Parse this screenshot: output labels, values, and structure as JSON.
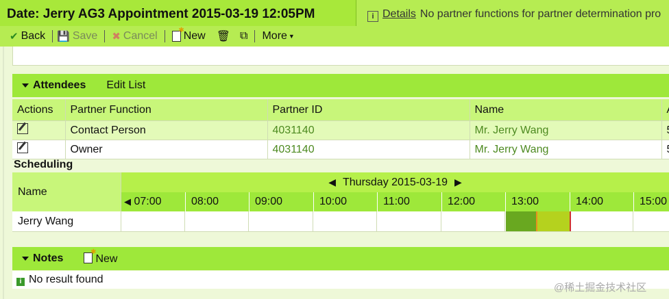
{
  "title": "Date: Jerry AG3 Appointment 2015-03-19 12:05PM",
  "message": {
    "icon": "info-icon",
    "link": "Details",
    "text": "No partner functions for partner determination pro"
  },
  "toolbar": {
    "back": "Back",
    "save": "Save",
    "cancel": "Cancel",
    "new": "New",
    "more": "More"
  },
  "attendees": {
    "title": "Attendees",
    "edit_list": "Edit List",
    "columns": [
      "Actions",
      "Partner Function",
      "Partner ID",
      "Name",
      "A"
    ],
    "rows": [
      {
        "function": "Contact Person",
        "partner_id": "4031140",
        "name": "Mr. Jerry Wang",
        "extra": "5"
      },
      {
        "function": "Owner",
        "partner_id": "4031140",
        "name": "Mr. Jerry Wang",
        "extra": "5"
      }
    ]
  },
  "scheduling": {
    "title": "Scheduling",
    "name_header": "Name",
    "date": "Thursday 2015-03-19",
    "hours": [
      "07:00",
      "08:00",
      "09:00",
      "10:00",
      "11:00",
      "12:00",
      "13:00",
      "14:00",
      "15:00"
    ],
    "row_name": "Jerry Wang"
  },
  "notes": {
    "title": "Notes",
    "new": "New",
    "empty": "No result found"
  },
  "watermark": "@稀土掘金技术社区",
  "colors": {
    "header": "#9ee83a",
    "busy": "#69a820",
    "tentative": "#b5d21e"
  }
}
